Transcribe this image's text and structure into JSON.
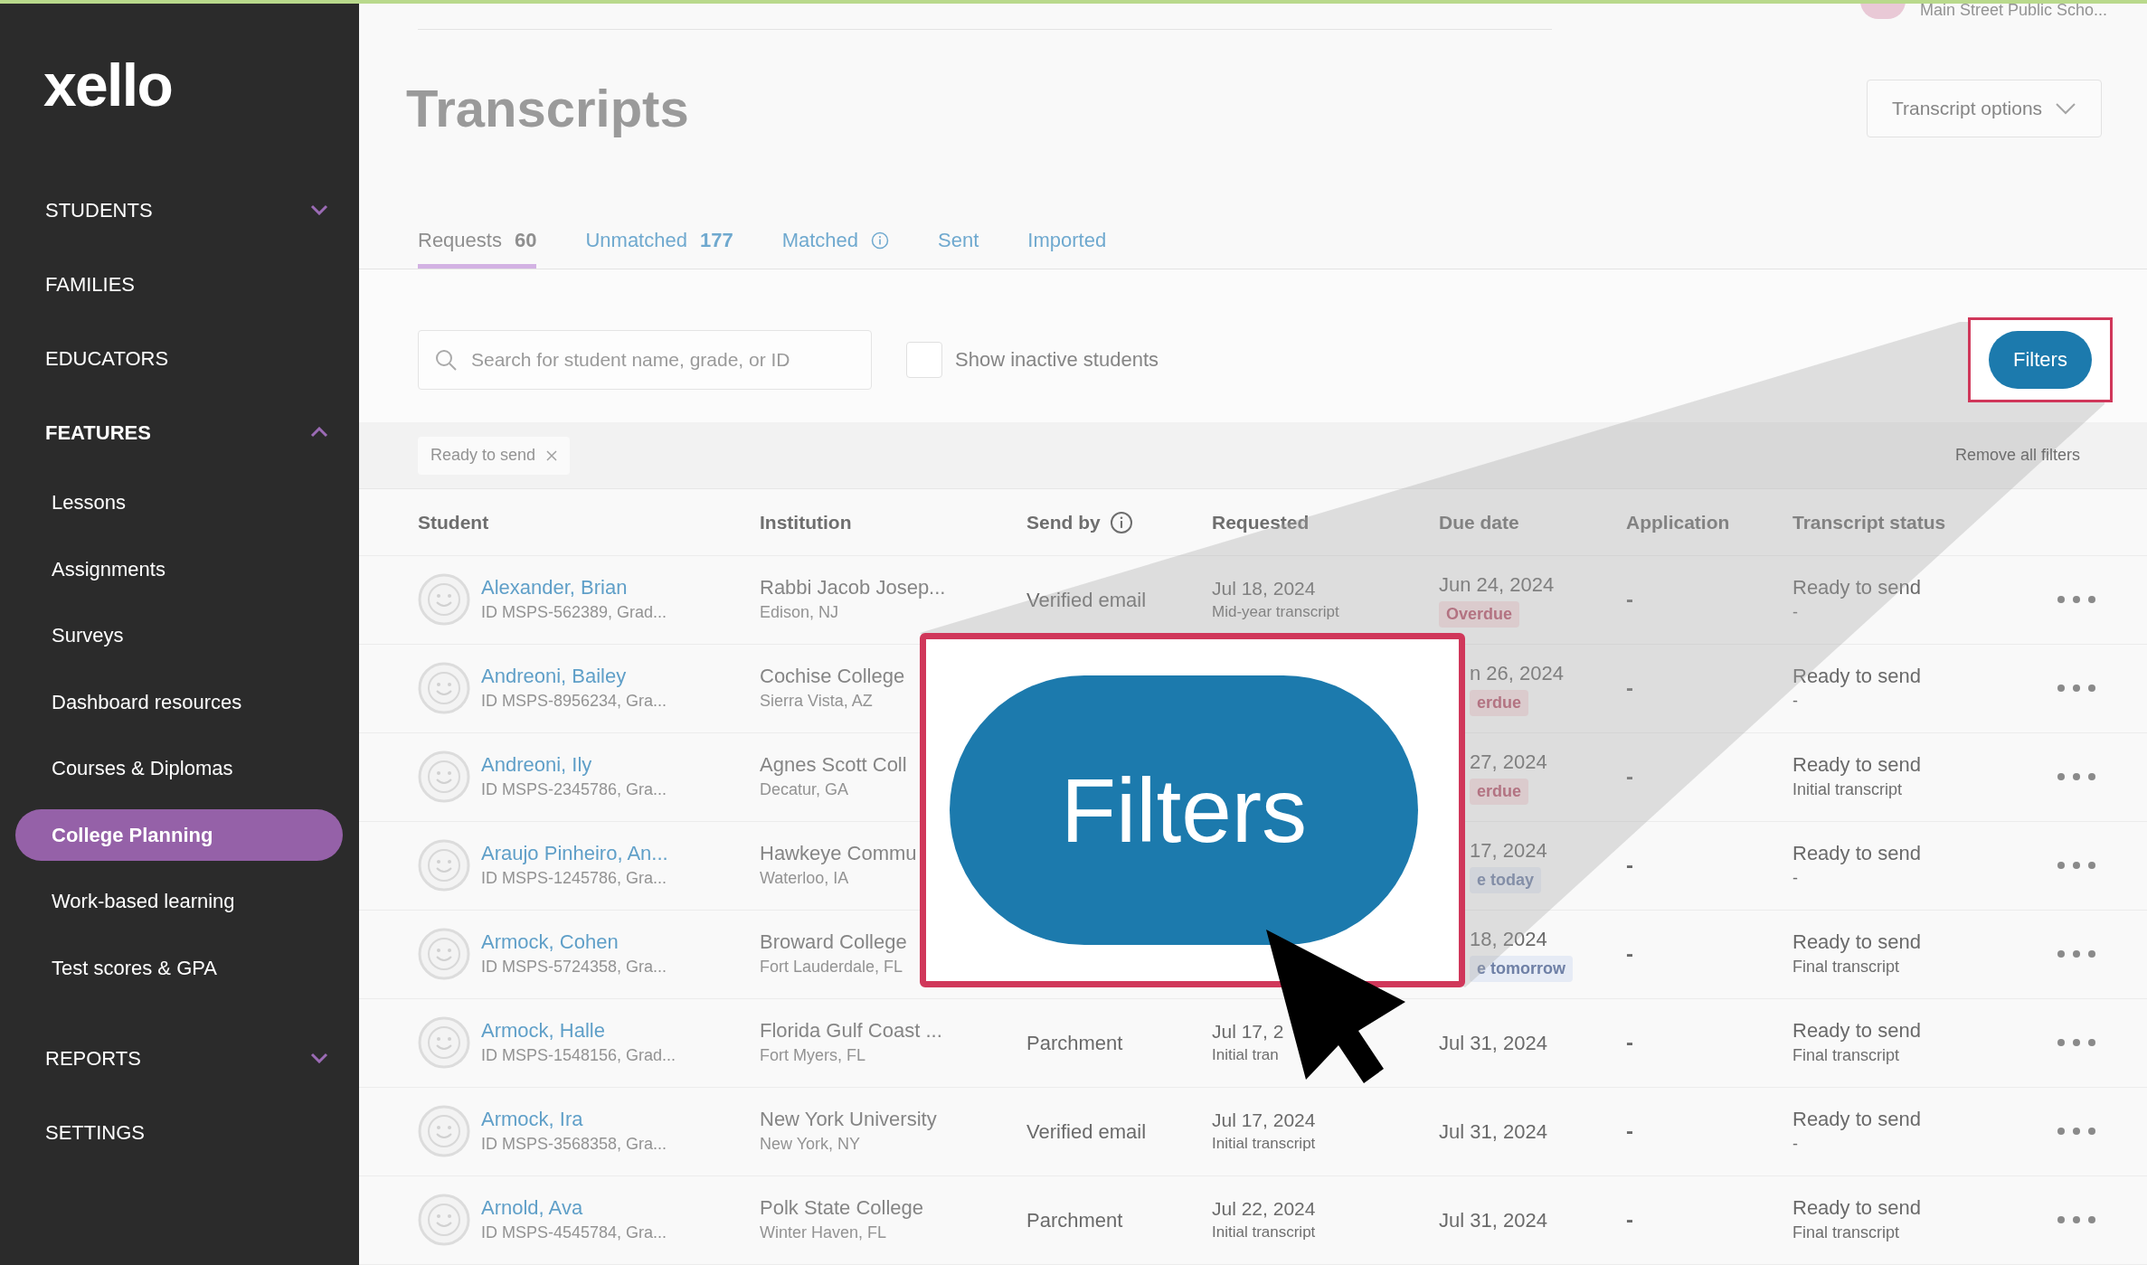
{
  "sidebar": {
    "logo": "xello",
    "items": [
      {
        "label": "STUDENTS",
        "kind": "group",
        "expanded": false
      },
      {
        "label": "FAMILIES",
        "kind": "link"
      },
      {
        "label": "EDUCATORS",
        "kind": "link"
      },
      {
        "label": "FEATURES",
        "kind": "group",
        "expanded": true,
        "children": [
          {
            "label": "Lessons",
            "selected": false
          },
          {
            "label": "Assignments",
            "selected": false
          },
          {
            "label": "Surveys",
            "selected": false
          },
          {
            "label": "Dashboard resources",
            "selected": false
          },
          {
            "label": "Courses & Diplomas",
            "selected": false
          },
          {
            "label": "College Planning",
            "selected": true
          },
          {
            "label": "Work-based learning",
            "selected": false
          },
          {
            "label": "Test scores & GPA",
            "selected": false
          }
        ]
      },
      {
        "label": "REPORTS",
        "kind": "group",
        "expanded": false
      },
      {
        "label": "SETTINGS",
        "kind": "link"
      }
    ]
  },
  "header": {
    "school": "Main Street Public Scho..."
  },
  "page": {
    "title": "Transcripts",
    "options_button": "Transcript options"
  },
  "tabs": [
    {
      "label": "Requests",
      "count": "60",
      "selected": true
    },
    {
      "label": "Unmatched",
      "count": "177",
      "selected": false
    },
    {
      "label": "Matched",
      "info": true,
      "selected": false
    },
    {
      "label": "Sent",
      "selected": false
    },
    {
      "label": "Imported",
      "selected": false
    }
  ],
  "toolbar": {
    "search_placeholder": "Search for student name, grade, or ID",
    "show_inactive": {
      "label": "Show inactive students",
      "checked": false
    },
    "filters_button": "Filters"
  },
  "active_filters": {
    "chips": [
      {
        "label": "Ready to send"
      }
    ],
    "remove_all": "Remove all filters"
  },
  "table": {
    "columns": [
      {
        "label": "Student"
      },
      {
        "label": "Institution"
      },
      {
        "label": "Send by",
        "info": true
      },
      {
        "label": "Requested"
      },
      {
        "label": "Due date"
      },
      {
        "label": "Application"
      },
      {
        "label": "Transcript status"
      }
    ],
    "rows": [
      {
        "name": "Alexander, Brian",
        "id_line": "ID MSPS-562389, Grad...",
        "institution": "Rabbi Jacob Josep...",
        "location": "Edison, NJ",
        "send_by": "Verified email",
        "requested": "Jul 18, 2024",
        "requested_note": "Mid-year transcript",
        "due_date": "Jun 24, 2024",
        "due_badge": {
          "text": "Overdue",
          "kind": "overdue"
        },
        "application": "-",
        "status": "Ready to send",
        "status_note": "-"
      },
      {
        "name": "Andreoni, Bailey",
        "id_line": "ID MSPS-8956234, Gra...",
        "institution": "Cochise College",
        "location": "Sierra Vista, AZ",
        "due_date": "n 26, 2024",
        "due_badge": {
          "text": "erdue",
          "kind": "overdue"
        },
        "application": "-",
        "status": "Ready to send",
        "status_note": "-"
      },
      {
        "name": "Andreoni, Ily",
        "id_line": "ID MSPS-2345786, Gra...",
        "institution": "Agnes Scott Coll",
        "location": "Decatur, GA",
        "due_date": "27, 2024",
        "due_badge": {
          "text": "erdue",
          "kind": "overdue"
        },
        "application": "-",
        "status": "Ready to send",
        "status_note": "Initial transcript"
      },
      {
        "name": "Araujo Pinheiro, An...",
        "id_line": "ID MSPS-1245786, Gra...",
        "institution": "Hawkeye Commu",
        "location": "Waterloo, IA",
        "due_date": "17, 2024",
        "due_badge": {
          "text": "e today",
          "kind": "soon"
        },
        "application": "-",
        "status": "Ready to send",
        "status_note": "-"
      },
      {
        "name": "Armock, Cohen",
        "id_line": "ID MSPS-5724358, Gra...",
        "institution": "Broward College",
        "location": "Fort Lauderdale, FL",
        "due_date": "18, 2024",
        "due_badge": {
          "text": "e tomorrow",
          "kind": "soon"
        },
        "application": "-",
        "status": "Ready to send",
        "status_note": "Final transcript"
      },
      {
        "name": "Armock, Halle",
        "id_line": "ID MSPS-1548156, Grad...",
        "institution": "Florida Gulf Coast ...",
        "location": "Fort Myers, FL",
        "send_by": "Parchment",
        "requested": "Jul 17, 2",
        "requested_note": "Initial tran",
        "due_date": "Jul 31, 2024",
        "application": "-",
        "status": "Ready to send",
        "status_note": "Final transcript"
      },
      {
        "name": "Armock, Ira",
        "id_line": "ID MSPS-3568358, Gra...",
        "institution": "New York University",
        "location": "New York, NY",
        "send_by": "Verified email",
        "requested": "Jul 17, 2024",
        "requested_note": "Initial transcript",
        "due_date": "Jul 31, 2024",
        "application": "-",
        "status": "Ready to send",
        "status_note": "-"
      },
      {
        "name": "Arnold, Ava",
        "id_line": "ID MSPS-4545784, Gra...",
        "institution": "Polk State College",
        "location": "Winter Haven, FL",
        "send_by": "Parchment",
        "requested": "Jul 22, 2024",
        "requested_note": "Initial transcript",
        "due_date": "Jul 31, 2024",
        "application": "-",
        "status": "Ready to send",
        "status_note": "Final transcript"
      }
    ]
  },
  "callout": {
    "button": "Filters"
  }
}
